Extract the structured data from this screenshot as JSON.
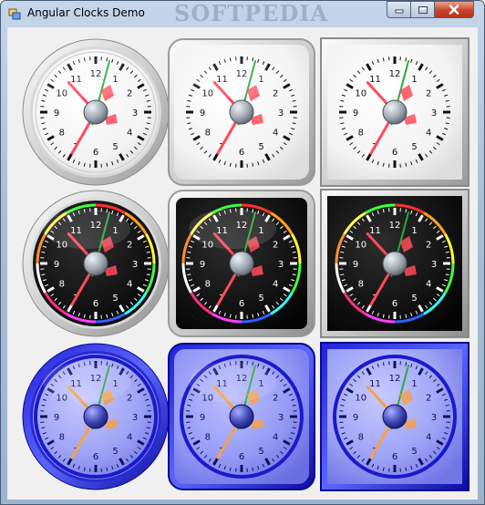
{
  "window": {
    "title": "Angular Clocks Demo",
    "watermark": "SOFTPEDIA",
    "minimize_icon": "minimize-icon",
    "maximize_icon": "maximize-icon",
    "close_icon": "close-icon"
  },
  "clock_time": {
    "hour": 10,
    "minute": 35,
    "second": 2.5
  },
  "clock_numerals": [
    "12",
    "1",
    "2",
    "3",
    "4",
    "5",
    "6",
    "7",
    "8",
    "9",
    "10",
    "11"
  ],
  "colors": {
    "silver_face": "#f4f4f4",
    "black_face": "#111111",
    "blue_face": "#8f94f0",
    "blue_ring": "#1a1acc",
    "hour_hand_silver": "#ff4b5c",
    "minute_hand_green": "#2fa83a",
    "hour_hand_blue": "#f5a04a"
  },
  "clocks": [
    {
      "id": "round-silver",
      "style": "silver",
      "frame": "round"
    },
    {
      "id": "rounded-square-silver",
      "style": "silver",
      "frame": "rounded-square"
    },
    {
      "id": "square-silver",
      "style": "silver",
      "frame": "square"
    },
    {
      "id": "round-black",
      "style": "black",
      "frame": "round"
    },
    {
      "id": "rounded-square-black",
      "style": "black",
      "frame": "rounded-square"
    },
    {
      "id": "square-black",
      "style": "black",
      "frame": "square"
    },
    {
      "id": "round-blue",
      "style": "blue",
      "frame": "round"
    },
    {
      "id": "rounded-square-blue",
      "style": "blue",
      "frame": "rounded-square"
    },
    {
      "id": "square-blue",
      "style": "blue",
      "frame": "square"
    }
  ]
}
